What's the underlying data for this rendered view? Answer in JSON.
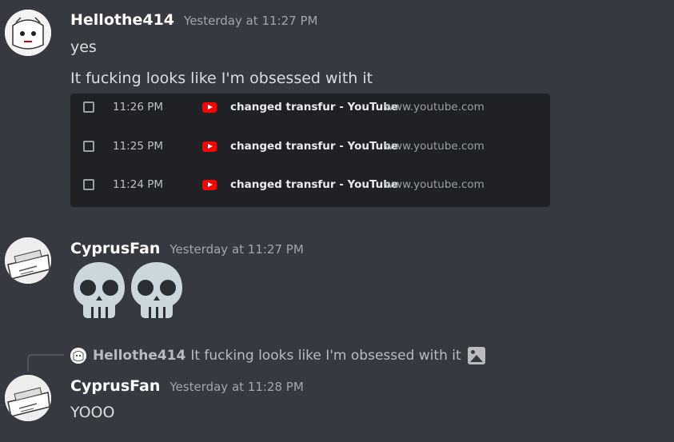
{
  "messages": [
    {
      "author": "Hellothe414",
      "timestamp": "Yesterday at 11:27 PM",
      "lines": [
        "yes",
        "It fucking looks like I'm obsessed with it"
      ],
      "history": [
        {
          "time": "11:26 PM",
          "title": "changed transfur - YouTube",
          "url": "www.youtube.com"
        },
        {
          "time": "11:25 PM",
          "title": "changed transfur - YouTube",
          "url": "www.youtube.com"
        },
        {
          "time": "11:24 PM",
          "title": "changed transfur - YouTube",
          "url": "www.youtube.com"
        }
      ]
    },
    {
      "author": "CyprusFan",
      "timestamp": "Yesterday at 11:27 PM",
      "emoji": [
        "skull-emoji",
        "skull-emoji"
      ]
    },
    {
      "reply": {
        "author": "Hellothe414",
        "text": "It fucking looks like I'm obsessed with it"
      },
      "author": "CyprusFan",
      "timestamp": "Yesterday at 11:28 PM",
      "text": "YOOO"
    }
  ],
  "icons": {
    "history_favicon": "youtube-icon",
    "history_checkbox": "checkbox-icon",
    "reply_attachment": "image-icon"
  },
  "colors": {
    "background": "#36393f",
    "embed_background": "#202124",
    "username": "#ffffff",
    "timestamp": "#a3a6aa",
    "youtube_red": "#ff0000"
  }
}
